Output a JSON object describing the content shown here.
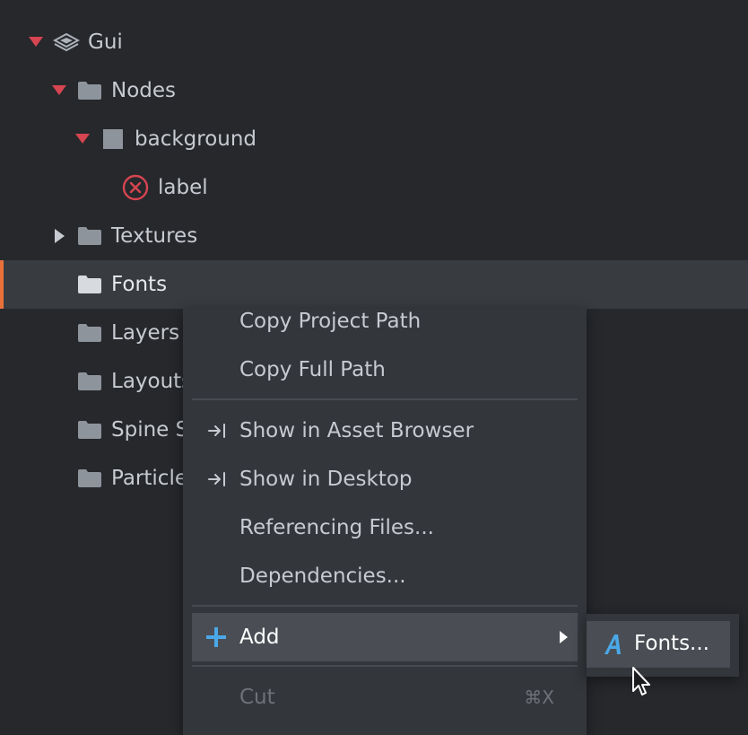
{
  "tree": {
    "items": [
      {
        "label": "Gui",
        "icon": "layers-icon"
      },
      {
        "label": "Nodes",
        "icon": "folder-icon"
      },
      {
        "label": "background",
        "icon": "box-node-icon"
      },
      {
        "label": "label",
        "icon": "error-circle-icon"
      },
      {
        "label": "Textures",
        "icon": "folder-icon"
      },
      {
        "label": "Fonts",
        "icon": "folder-icon"
      },
      {
        "label": "Layers",
        "icon": "folder-icon"
      },
      {
        "label": "Layouts",
        "icon": "folder-icon"
      },
      {
        "label": "Spine S",
        "icon": "folder-icon"
      },
      {
        "label": "Particle",
        "icon": "folder-icon"
      }
    ]
  },
  "context_menu": {
    "copy_project_path": "Copy Project Path",
    "copy_full_path": "Copy Full Path",
    "show_in_asset_browser": "Show in Asset Browser",
    "show_in_desktop": "Show in Desktop",
    "referencing_files": "Referencing Files...",
    "dependencies": "Dependencies...",
    "add": "Add",
    "cut": "Cut",
    "cut_shortcut": "⌘X"
  },
  "submenu": {
    "fonts": "Fonts..."
  },
  "colors": {
    "background": "#26282c",
    "selection_accent": "#e8713a",
    "expand_arrow": "#d64550",
    "error": "#d64550",
    "add_icon": "#4aa8e8"
  }
}
